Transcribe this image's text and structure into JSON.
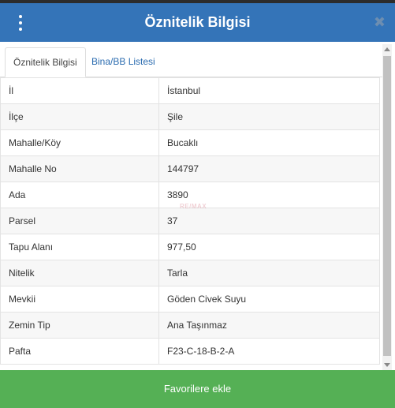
{
  "header": {
    "title": "Öznitelik Bilgisi",
    "menu_icon": "vertical-dots-icon",
    "close_icon": "close-icon",
    "close_glyph": "✖"
  },
  "tabs": [
    {
      "label": "Öznitelik Bilgisi",
      "active": true
    },
    {
      "label": "Bina/BB Listesi",
      "active": false
    }
  ],
  "attributes": [
    {
      "key": "İl",
      "value": "İstanbul"
    },
    {
      "key": "İlçe",
      "value": "Şile"
    },
    {
      "key": "Mahalle/Köy",
      "value": "Bucaklı"
    },
    {
      "key": "Mahalle No",
      "value": "144797"
    },
    {
      "key": "Ada",
      "value": "3890"
    },
    {
      "key": "Parsel",
      "value": "37"
    },
    {
      "key": "Tapu Alanı",
      "value": "977,50"
    },
    {
      "key": "Nitelik",
      "value": "Tarla"
    },
    {
      "key": "Mevkii",
      "value": "Göden Civek Suyu"
    },
    {
      "key": "Zemin Tip",
      "value": "Ana Taşınmaz"
    },
    {
      "key": "Pafta",
      "value": "F23-C-18-B-2-A"
    }
  ],
  "watermark": "RE/MAX",
  "footer": {
    "button_label": "Favorilere ekle"
  },
  "colors": {
    "header_bg": "#3474b8",
    "footer_bg": "#55b055",
    "tab_link": "#2b6cb0"
  }
}
